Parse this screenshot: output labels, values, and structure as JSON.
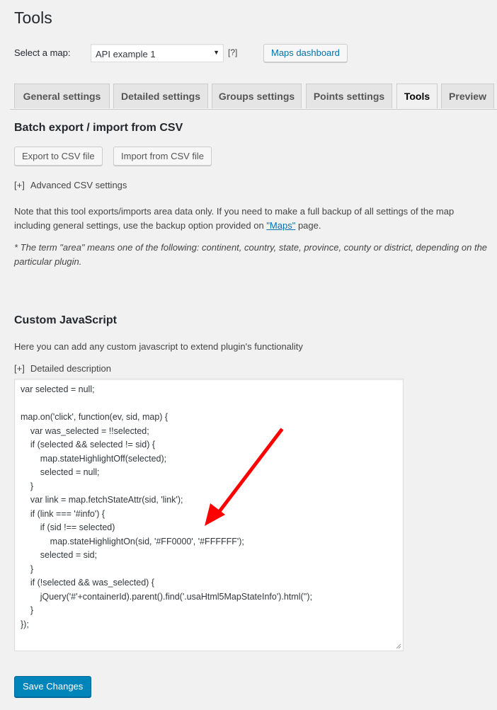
{
  "page": {
    "title": "Tools"
  },
  "map_selector": {
    "label": "Select a map:",
    "selected": "API example 1",
    "arrow": "▼",
    "help": "[?]",
    "dashboard_button": "Maps dashboard"
  },
  "tabs": [
    {
      "label": "General settings",
      "active": false
    },
    {
      "label": "Detailed settings",
      "active": false
    },
    {
      "label": "Groups settings",
      "active": false
    },
    {
      "label": "Points settings",
      "active": false
    },
    {
      "label": "Tools",
      "active": true
    },
    {
      "label": "Preview",
      "active": false
    }
  ],
  "csv": {
    "title": "Batch export / import from CSV",
    "export_button": "Export to CSV file",
    "import_button": "Import from CSV file",
    "advanced_toggle_bracket": "[+]",
    "advanced_toggle_label": "Advanced CSV settings",
    "note_before_link": "Note that this tool exports/imports area data only. If you need to make a full backup of all settings of the map including general settings, use the backup option provided on ",
    "note_link": "\"Maps\"",
    "note_after_link": " page.",
    "footnote": "* The term \"area\" means one of the following: continent, country, state, province, county or district, depending on the particular plugin."
  },
  "custom_js": {
    "title": "Custom JavaScript",
    "description": "Here you can add any custom javascript to extend plugin's functionality",
    "details_toggle_bracket": "[+]",
    "details_toggle_label": "Detailed description",
    "code": "var selected = null;\n\nmap.on('click', function(ev, sid, map) {\n    var was_selected = !!selected;\n    if (selected && selected != sid) {\n        map.stateHighlightOff(selected);\n        selected = null;\n    }\n    var link = map.fetchStateAttr(sid, 'link');\n    if (link === '#info') {\n        if (sid !== selected)\n            map.stateHighlightOn(sid, '#FF0000', '#FFFFFF');\n        selected = sid;\n    }\n    if (!selected && was_selected) {\n        jQuery('#'+containerId).parent().find('.usaHtml5MapStateInfo').html('');\n    }\n});"
  },
  "annotation": {
    "arrow_color": "#FF0000"
  },
  "footer": {
    "save_button": "Save Changes"
  },
  "colors": {
    "primary": "#0085ba",
    "link": "#0073aa",
    "background": "#f1f1f1"
  }
}
